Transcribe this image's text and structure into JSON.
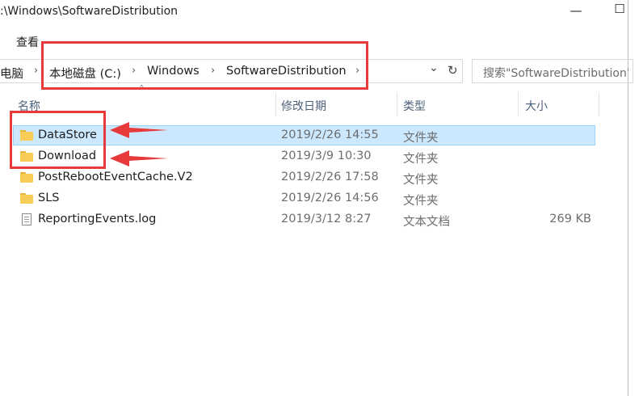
{
  "window": {
    "title": ":\\Windows\\SoftwareDistribution",
    "minimize_glyph": "—",
    "maximize_glyph": "☐"
  },
  "menu": {
    "view_label": "查看"
  },
  "address": {
    "crumbs": [
      "电脑",
      "本地磁盘 (C:)",
      "Windows",
      "SoftwareDistribution"
    ],
    "separator": "›",
    "dropdown_glyph": "⌄",
    "refresh_glyph": "↻"
  },
  "search": {
    "placeholder": "搜索\"SoftwareDistribution\""
  },
  "columns": {
    "name": "名称",
    "date": "修改日期",
    "type": "类型",
    "size": "大小",
    "sort_glyph": "ˆ"
  },
  "files": [
    {
      "name": "DataStore",
      "date": "2019/2/26 14:55",
      "type": "文件夹",
      "size": "",
      "icon": "folder-icon"
    },
    {
      "name": "Download",
      "date": "2019/3/9 10:30",
      "type": "文件夹",
      "size": "",
      "icon": "folder-icon"
    },
    {
      "name": "PostRebootEventCache.V2",
      "date": "2019/2/26 17:58",
      "type": "文件夹",
      "size": "",
      "icon": "folder-icon"
    },
    {
      "name": "SLS",
      "date": "2019/2/26 14:56",
      "type": "文件夹",
      "size": "",
      "icon": "folder-icon"
    },
    {
      "name": "ReportingEvents.log",
      "date": "2019/3/12 8:27",
      "type": "文本文档",
      "size": "269 KB",
      "icon": "text-file-icon"
    }
  ],
  "annotation_color": "#e8393b",
  "selection_color": "#cce8ff"
}
